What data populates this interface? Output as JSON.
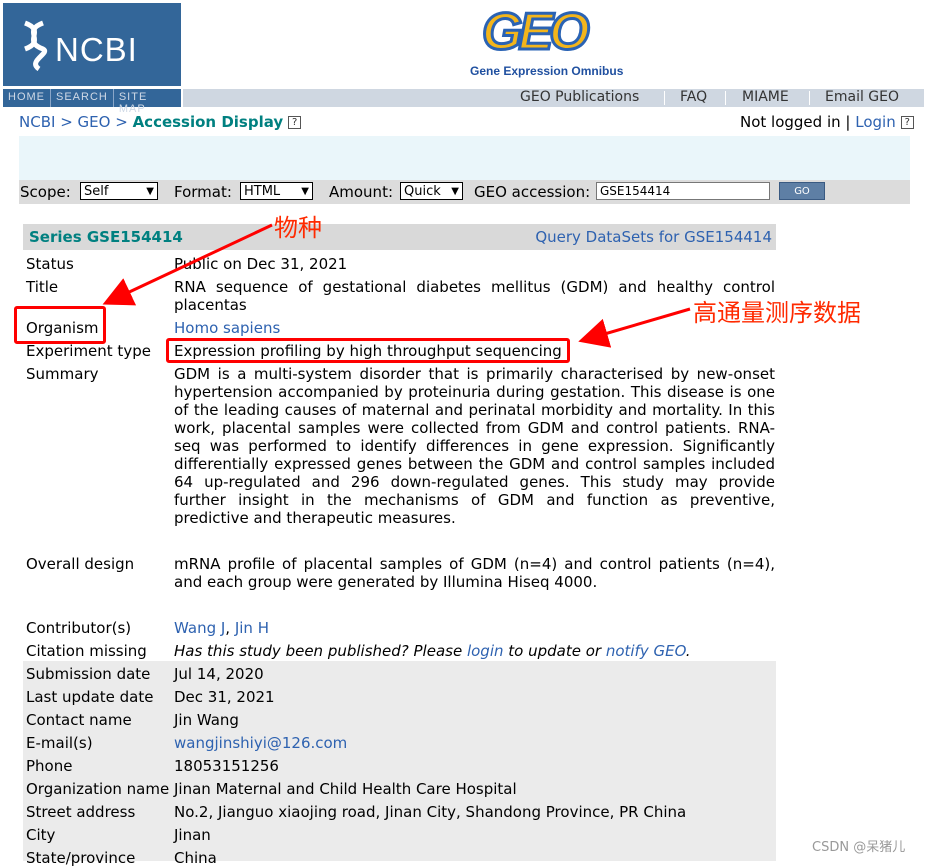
{
  "header": {
    "ncbi_logo": "NCBI",
    "geo_logo": "GEO",
    "geo_subtitle": "Gene Expression Omnibus",
    "left_nav": [
      "HOME",
      "SEARCH",
      "SITE MAP"
    ],
    "right_nav": [
      "GEO Publications",
      "FAQ",
      "MIAME",
      "Email GEO"
    ]
  },
  "breadcrumb": {
    "ncbi": "NCBI",
    "sep1": " > ",
    "geo": "GEO",
    "sep2": " > ",
    "current": "Accession Display",
    "help": "?"
  },
  "login": {
    "status": "Not logged in",
    "divider": "|",
    "link": "Login",
    "help": "?"
  },
  "search": {
    "scope_label": "Scope:",
    "scope_value": "Self",
    "format_label": "Format:",
    "format_value": "HTML",
    "amount_label": "Amount:",
    "amount_value": "Quick",
    "accession_label": "GEO accession:",
    "accession_value": "GSE154414",
    "go_label": "GO"
  },
  "series": {
    "title": "Series GSE154414",
    "query_link": "Query DataSets for GSE154414"
  },
  "fields": {
    "status": {
      "label": "Status",
      "value": "Public on Dec 31, 2021"
    },
    "title": {
      "label": "Title",
      "value": "RNA sequence of gestational diabetes mellitus (GDM) and healthy control placentas"
    },
    "organism": {
      "label": "Organism",
      "value": "Homo sapiens"
    },
    "experiment_type": {
      "label": "Experiment type",
      "value": "Expression profiling by high throughput sequencing"
    },
    "summary": {
      "label": "Summary",
      "value": "GDM is a multi-system disorder that is primarily characterised by new-onset hypertension accompanied by proteinuria during gestation. This disease is one of the leading causes of maternal and perinatal morbidity and mortality. In this work, placental samples were collected from GDM and control patients. RNA-seq was performed to identify differences in gene expression. Significantly differentially expressed genes between the GDM and control samples included 64 up-regulated and 296 down-regulated genes. This study may provide further insight in the mechanisms of GDM and function as preventive, predictive and therapeutic measures."
    },
    "overall_design": {
      "label": "Overall design",
      "value": "mRNA profile of placental samples of GDM (n=4) and control patients (n=4), and each group were generated by Illumina Hiseq 4000."
    },
    "contributors": {
      "label": "Contributor(s)",
      "names": [
        "Wang J",
        "Jin H"
      ],
      "sep": ", "
    },
    "citation": {
      "label": "Citation missing",
      "text1": "Has this study been published? Please ",
      "link1": "login",
      "text2": " to update or ",
      "link2": "notify GEO",
      "text3": "."
    },
    "submission_date": {
      "label": "Submission date",
      "value": "Jul 14, 2020"
    },
    "last_update": {
      "label": "Last update date",
      "value": "Dec 31, 2021"
    },
    "contact_name": {
      "label": "Contact name",
      "value": "Jin Wang"
    },
    "email": {
      "label": "E-mail(s)",
      "value": "wangjinshiyi@126.com"
    },
    "phone": {
      "label": "Phone",
      "value": "18053151256"
    },
    "organization": {
      "label": "Organization name",
      "value": "Jinan Maternal and Child Health Care Hospital"
    },
    "street": {
      "label": "Street address",
      "value": "No.2, Jianguo xiaojing road, Jinan City, Shandong Province, PR China"
    },
    "city": {
      "label": "City",
      "value": "Jinan"
    },
    "state": {
      "label": "State/province",
      "value": "China"
    }
  },
  "annotations": {
    "species": "物种",
    "high_throughput": "高通量测序数据",
    "color": "#ff0000"
  },
  "watermark": "CSDN @呆猪儿"
}
